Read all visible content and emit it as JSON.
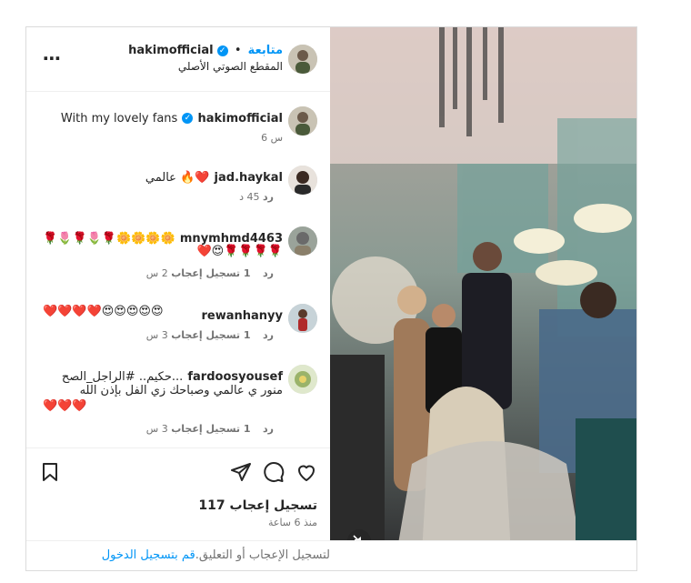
{
  "post": {
    "username": "hakimofficial",
    "follow_label": "متابعة",
    "dot": "•",
    "audio_label": "المقطع الصوتي الأصلي",
    "more_icon": "⋯",
    "caption_user": "hakimofficial",
    "caption_text": "With my lovely fans",
    "caption_time": "6 س",
    "likes": "117 تسجيل إعجاب",
    "time_ago": "منذ 6 ساعة",
    "login_link": "قم بتسجيل الدخول",
    "login_text": " لتسجيل الإعجاب أو التعليق."
  },
  "comments": [
    {
      "user": "jad.haykal",
      "text": "عالمي 🔥❤️",
      "time": "45 د",
      "likes": "",
      "reply": "رد"
    },
    {
      "user": "mnymhmd4463",
      "line1": "🌹🌷🌹🌷🌹🌼🌼🌼🌼",
      "line2": "❤️😍🌹🌹🌹🌹",
      "time": "2 س",
      "likes": "1 تسجيل إعجاب",
      "reply": "رد"
    },
    {
      "user": "rewanhanyy",
      "text": "❤️❤️❤️❤️😍😍😍😍😍",
      "time": "3 س",
      "likes": "1 تسجيل إعجاب",
      "reply": "رد"
    },
    {
      "user": "fardoosyousef",
      "line1": "حكيم.. #الراجل_الصح...",
      "line2": "منور ي عالمي وصباحك زي الفل بإذن الله",
      "line3": "❤️❤️❤️",
      "time": "3 س",
      "likes": "1 تسجيل إعجاب",
      "reply": "رد"
    }
  ],
  "icons": [
    "more-icon",
    "verified-icon",
    "heart-icon",
    "comment-icon",
    "share-icon",
    "save-icon",
    "mute-icon"
  ],
  "colors": {
    "accent": "#0095f6",
    "text": "#262626",
    "muted": "#737373",
    "heart": "#e0245e"
  }
}
